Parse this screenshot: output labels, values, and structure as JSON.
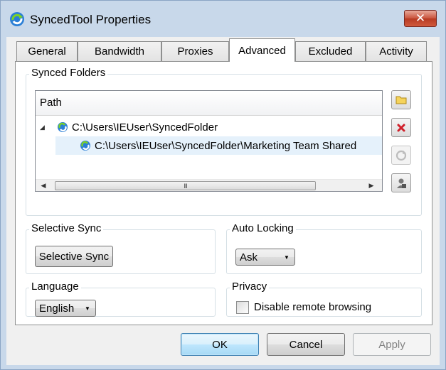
{
  "window": {
    "title": "SyncedTool Properties",
    "close_symbol": "✕"
  },
  "tabs": [
    {
      "label": "General",
      "active": false
    },
    {
      "label": "Bandwidth",
      "active": false
    },
    {
      "label": "Proxies",
      "active": false
    },
    {
      "label": "Advanced",
      "active": true
    },
    {
      "label": "Excluded",
      "active": false
    },
    {
      "label": "Activity",
      "active": false
    }
  ],
  "synced_folders": {
    "label": "Synced Folders",
    "column_header": "Path",
    "rows": [
      {
        "path": "C:\\Users\\IEUser\\SyncedFolder",
        "expanded": true,
        "selected": false
      },
      {
        "path": "C:\\Users\\IEUser\\SyncedFolder\\Marketing Team Shared",
        "expanded": false,
        "selected": true
      }
    ],
    "expander_symbol": "◢",
    "scroll": {
      "left_arrow": "◀",
      "right_arrow": "▶",
      "grip": "III"
    },
    "side_buttons": [
      {
        "name": "browse-folder-button",
        "icon": "folder-icon",
        "enabled": true
      },
      {
        "name": "remove-folder-button",
        "icon": "delete-x-icon",
        "enabled": true
      },
      {
        "name": "refresh-folder-button",
        "icon": "sync-icon",
        "enabled": false
      },
      {
        "name": "permissions-button",
        "icon": "user-lock-icon",
        "enabled": true
      }
    ]
  },
  "selective_sync": {
    "label": "Selective Sync",
    "button_label": "Selective Sync"
  },
  "auto_locking": {
    "label": "Auto Locking",
    "selected": "Ask",
    "dropdown_symbol": "▼"
  },
  "language": {
    "label": "Language",
    "selected": "English",
    "dropdown_symbol": "▼"
  },
  "privacy": {
    "label": "Privacy",
    "checkbox_label": "Disable remote browsing",
    "checked": false
  },
  "footer": {
    "ok_label": "OK",
    "cancel_label": "Cancel",
    "apply_label": "Apply"
  },
  "colors": {
    "title_bar": "#c8d8ea",
    "close_button": "#c9533c",
    "selected_row": "#e5f1fb",
    "default_button_border": "#3c7fb1"
  }
}
